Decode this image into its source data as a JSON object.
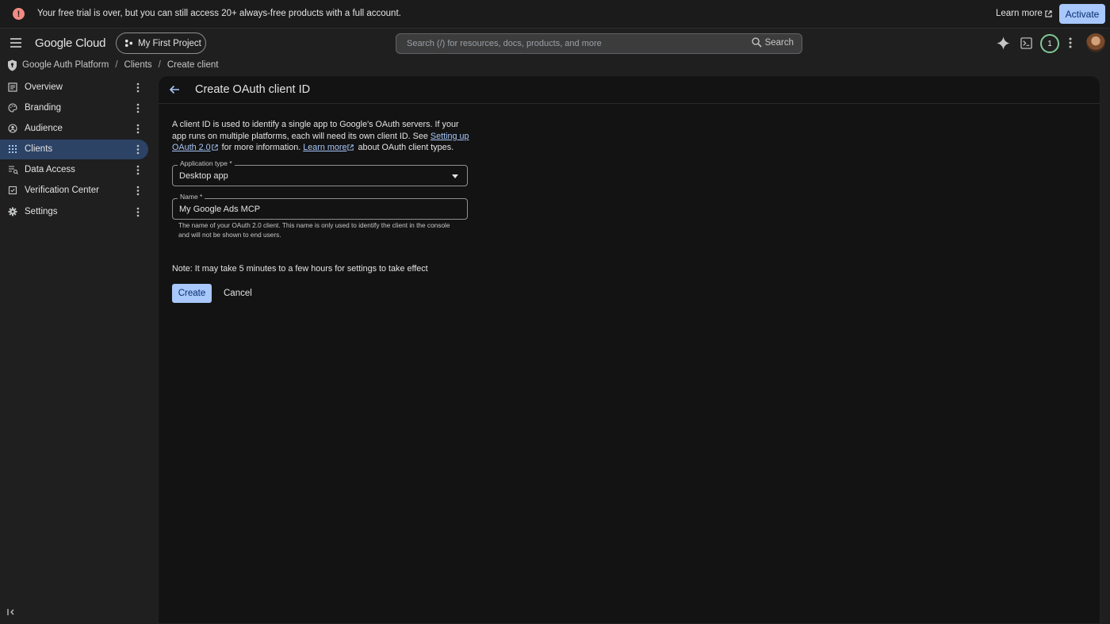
{
  "banner": {
    "message": "Your free trial is over, but you can still access 20+ always-free products with a full account.",
    "learn_more": "Learn more",
    "activate": "Activate"
  },
  "header": {
    "logo": "Google Cloud",
    "project": "My First Project",
    "search_placeholder": "Search (/) for resources, docs, products, and more",
    "search_button": "Search",
    "notification_count": "1"
  },
  "breadcrumb": {
    "items": [
      "Google Auth Platform",
      "Clients",
      "Create client"
    ],
    "separator": "/"
  },
  "sidebar": {
    "items": [
      {
        "label": "Overview",
        "icon": "overview-icon"
      },
      {
        "label": "Branding",
        "icon": "palette-icon"
      },
      {
        "label": "Audience",
        "icon": "person-icon"
      },
      {
        "label": "Clients",
        "icon": "grid-icon",
        "active": true
      },
      {
        "label": "Data Access",
        "icon": "data-access-icon"
      },
      {
        "label": "Verification Center",
        "icon": "verification-icon"
      },
      {
        "label": "Settings",
        "icon": "gear-icon"
      }
    ]
  },
  "main": {
    "title": "Create OAuth client ID",
    "description": {
      "part1": "A client ID is used to identify a single app to Google's OAuth servers. If your app runs on multiple platforms, each will need its own client ID. See ",
      "link1": "Setting up OAuth 2.0",
      "part2": " for more information. ",
      "link2": "Learn more",
      "part3": " about OAuth client types."
    },
    "app_type": {
      "label": "Application type *",
      "value": "Desktop app"
    },
    "name": {
      "label": "Name *",
      "value": "My Google Ads MCP"
    },
    "name_help": "The name of your OAuth 2.0 client. This name is only used to identify the client in the console and will not be shown to end users.",
    "note": "Note: It may take 5 minutes to a few hours for settings to take effect",
    "create": "Create",
    "cancel": "Cancel"
  },
  "colors": {
    "accent": "#a8c7fa",
    "background": "#1f1f1f",
    "panel": "#131313",
    "active_nav": "#2c4366",
    "warning": "#f28b82"
  }
}
